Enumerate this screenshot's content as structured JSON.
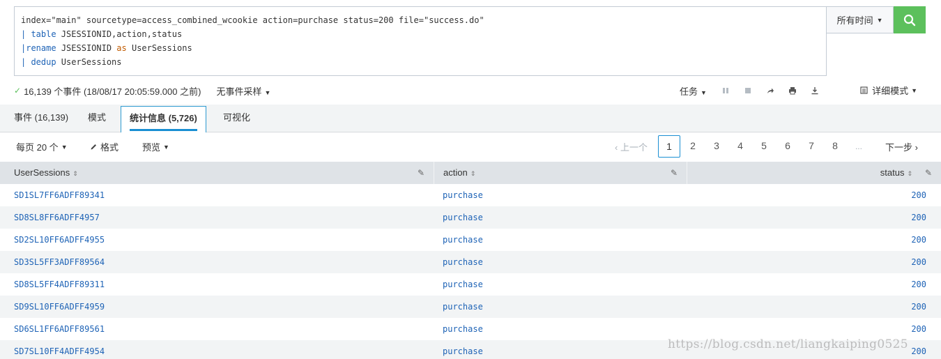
{
  "search": {
    "lines": [
      [
        {
          "t": "index=\"main\" sourcetype=access_combined_wcookie action=purchase status=200 file=\"success.do\"",
          "c": ""
        }
      ],
      [
        {
          "t": "| ",
          "c": "kw"
        },
        {
          "t": "table",
          "c": "kw"
        },
        {
          "t": " JSESSIONID,action,status",
          "c": ""
        }
      ],
      [
        {
          "t": "|",
          "c": "kw"
        },
        {
          "t": "rename",
          "c": "kw"
        },
        {
          "t": " JSESSIONID ",
          "c": ""
        },
        {
          "t": "as",
          "c": "kw-orange"
        },
        {
          "t": " UserSessions",
          "c": ""
        }
      ],
      [
        {
          "t": "| ",
          "c": "kw"
        },
        {
          "t": "dedup",
          "c": "kw"
        },
        {
          "t": " UserSessions",
          "c": ""
        }
      ]
    ],
    "time_label": "所有时间"
  },
  "status": {
    "events_text": "16,139 个事件 (18/08/17 20:05:59.000 之前)",
    "sampling_label": "无事件采样",
    "job_label": "任务",
    "mode_label": "详细模式"
  },
  "tabs": [
    {
      "label": "事件 (16,139)"
    },
    {
      "label": "模式"
    },
    {
      "label": "统计信息 (5,726)"
    },
    {
      "label": "可视化"
    }
  ],
  "toolbar": {
    "per_page": "每页 20 个",
    "format": "格式",
    "preview": "预览"
  },
  "pagination": {
    "prev": "上一个",
    "pages": [
      "1",
      "2",
      "3",
      "4",
      "5",
      "6",
      "7",
      "8"
    ],
    "ellipsis": "...",
    "next": "下一步",
    "current": "1"
  },
  "table": {
    "columns": [
      "UserSessions",
      "action",
      "status"
    ],
    "rows": [
      [
        "SD1SL7FF6ADFF89341",
        "purchase",
        "200"
      ],
      [
        "SD8SL8FF6ADFF4957",
        "purchase",
        "200"
      ],
      [
        "SD2SL10FF6ADFF4955",
        "purchase",
        "200"
      ],
      [
        "SD3SL5FF3ADFF89564",
        "purchase",
        "200"
      ],
      [
        "SD8SL5FF4ADFF89311",
        "purchase",
        "200"
      ],
      [
        "SD9SL10FF6ADFF4959",
        "purchase",
        "200"
      ],
      [
        "SD6SL1FF6ADFF89561",
        "purchase",
        "200"
      ],
      [
        "SD7SL10FF4ADFF4954",
        "purchase",
        "200"
      ]
    ]
  },
  "watermark": "https://blog.csdn.net/liangkaiping0525",
  "colors": {
    "accent": "#1a8fd3",
    "search_button": "#5cc05c",
    "link": "#1e63b6",
    "header_bg": "#dfe3e7"
  }
}
